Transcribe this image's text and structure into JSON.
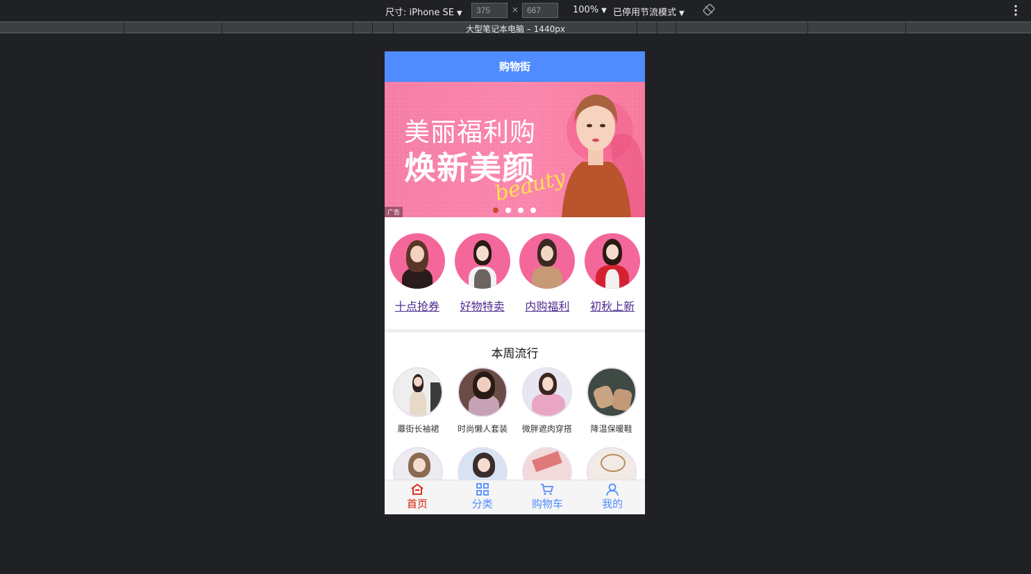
{
  "devtools": {
    "size_label": "尺寸: iPhone SE",
    "width": "375",
    "times": "×",
    "height": "667",
    "zoom": "100%",
    "throttle": "已停用节流模式",
    "ruler_label": "大型笔记本电脑 – 1440px"
  },
  "app": {
    "title": "购物街",
    "banner": {
      "line1": "美丽福利购",
      "line2": "焕新美颜",
      "script": "beauty",
      "ad_label": "广告",
      "slides": 4,
      "active_slide": 0
    },
    "recommend": [
      {
        "label": "十点抢券"
      },
      {
        "label": "好物特卖"
      },
      {
        "label": "内购福利"
      },
      {
        "label": "初秋上新"
      }
    ],
    "popular": {
      "title": "本周流行",
      "items": [
        {
          "label": "蘼街长袖裙"
        },
        {
          "label": "时尚懒人套装"
        },
        {
          "label": "微胖遮肉穿搭"
        },
        {
          "label": "降温保暖鞋"
        },
        {
          "label": ""
        },
        {
          "label": ""
        },
        {
          "label": ""
        },
        {
          "label": ""
        }
      ]
    },
    "tabbar": [
      {
        "label": "首页",
        "icon": "home-icon",
        "active": true
      },
      {
        "label": "分类",
        "icon": "category-icon",
        "active": false
      },
      {
        "label": "购物车",
        "icon": "cart-icon",
        "active": false
      },
      {
        "label": "我的",
        "icon": "profile-icon",
        "active": false
      }
    ]
  },
  "colors": {
    "header": "#508cff",
    "tab_active": "#d81e06",
    "tab_inactive": "#508cff",
    "banner": "#fb86ad"
  }
}
